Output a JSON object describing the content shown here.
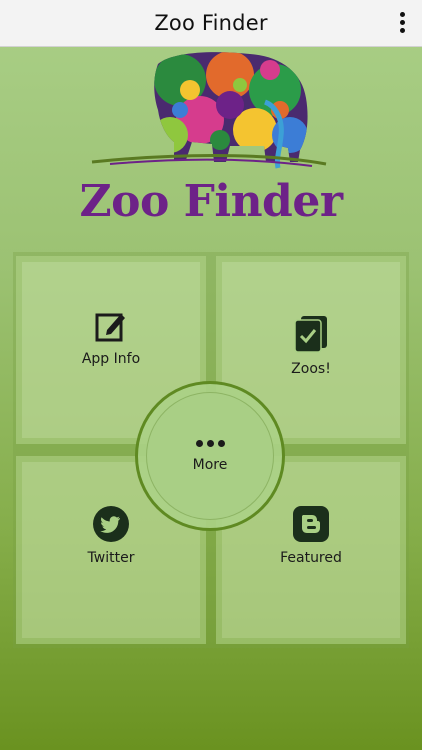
{
  "header": {
    "title": "Zoo Finder",
    "menu_icon": "more-vert-icon"
  },
  "logo": {
    "text": "Zoo Finder",
    "icon": "elephant-logo"
  },
  "tiles": [
    {
      "label": "App Info",
      "icon": "edit-icon"
    },
    {
      "label": "Zoos!",
      "icon": "checkbook-icon"
    },
    {
      "label": "Twitter",
      "icon": "twitter-icon"
    },
    {
      "label": "Featured",
      "icon": "blogger-icon"
    }
  ],
  "center": {
    "label": "More",
    "icon": "more-horiz-icon"
  },
  "colors": {
    "header_bg": "#f3f3f3",
    "logo_text": "#6d2288",
    "bg_top": "#aacf87",
    "bg_bottom": "#6a9220",
    "circle_border": "#5f8a22"
  }
}
